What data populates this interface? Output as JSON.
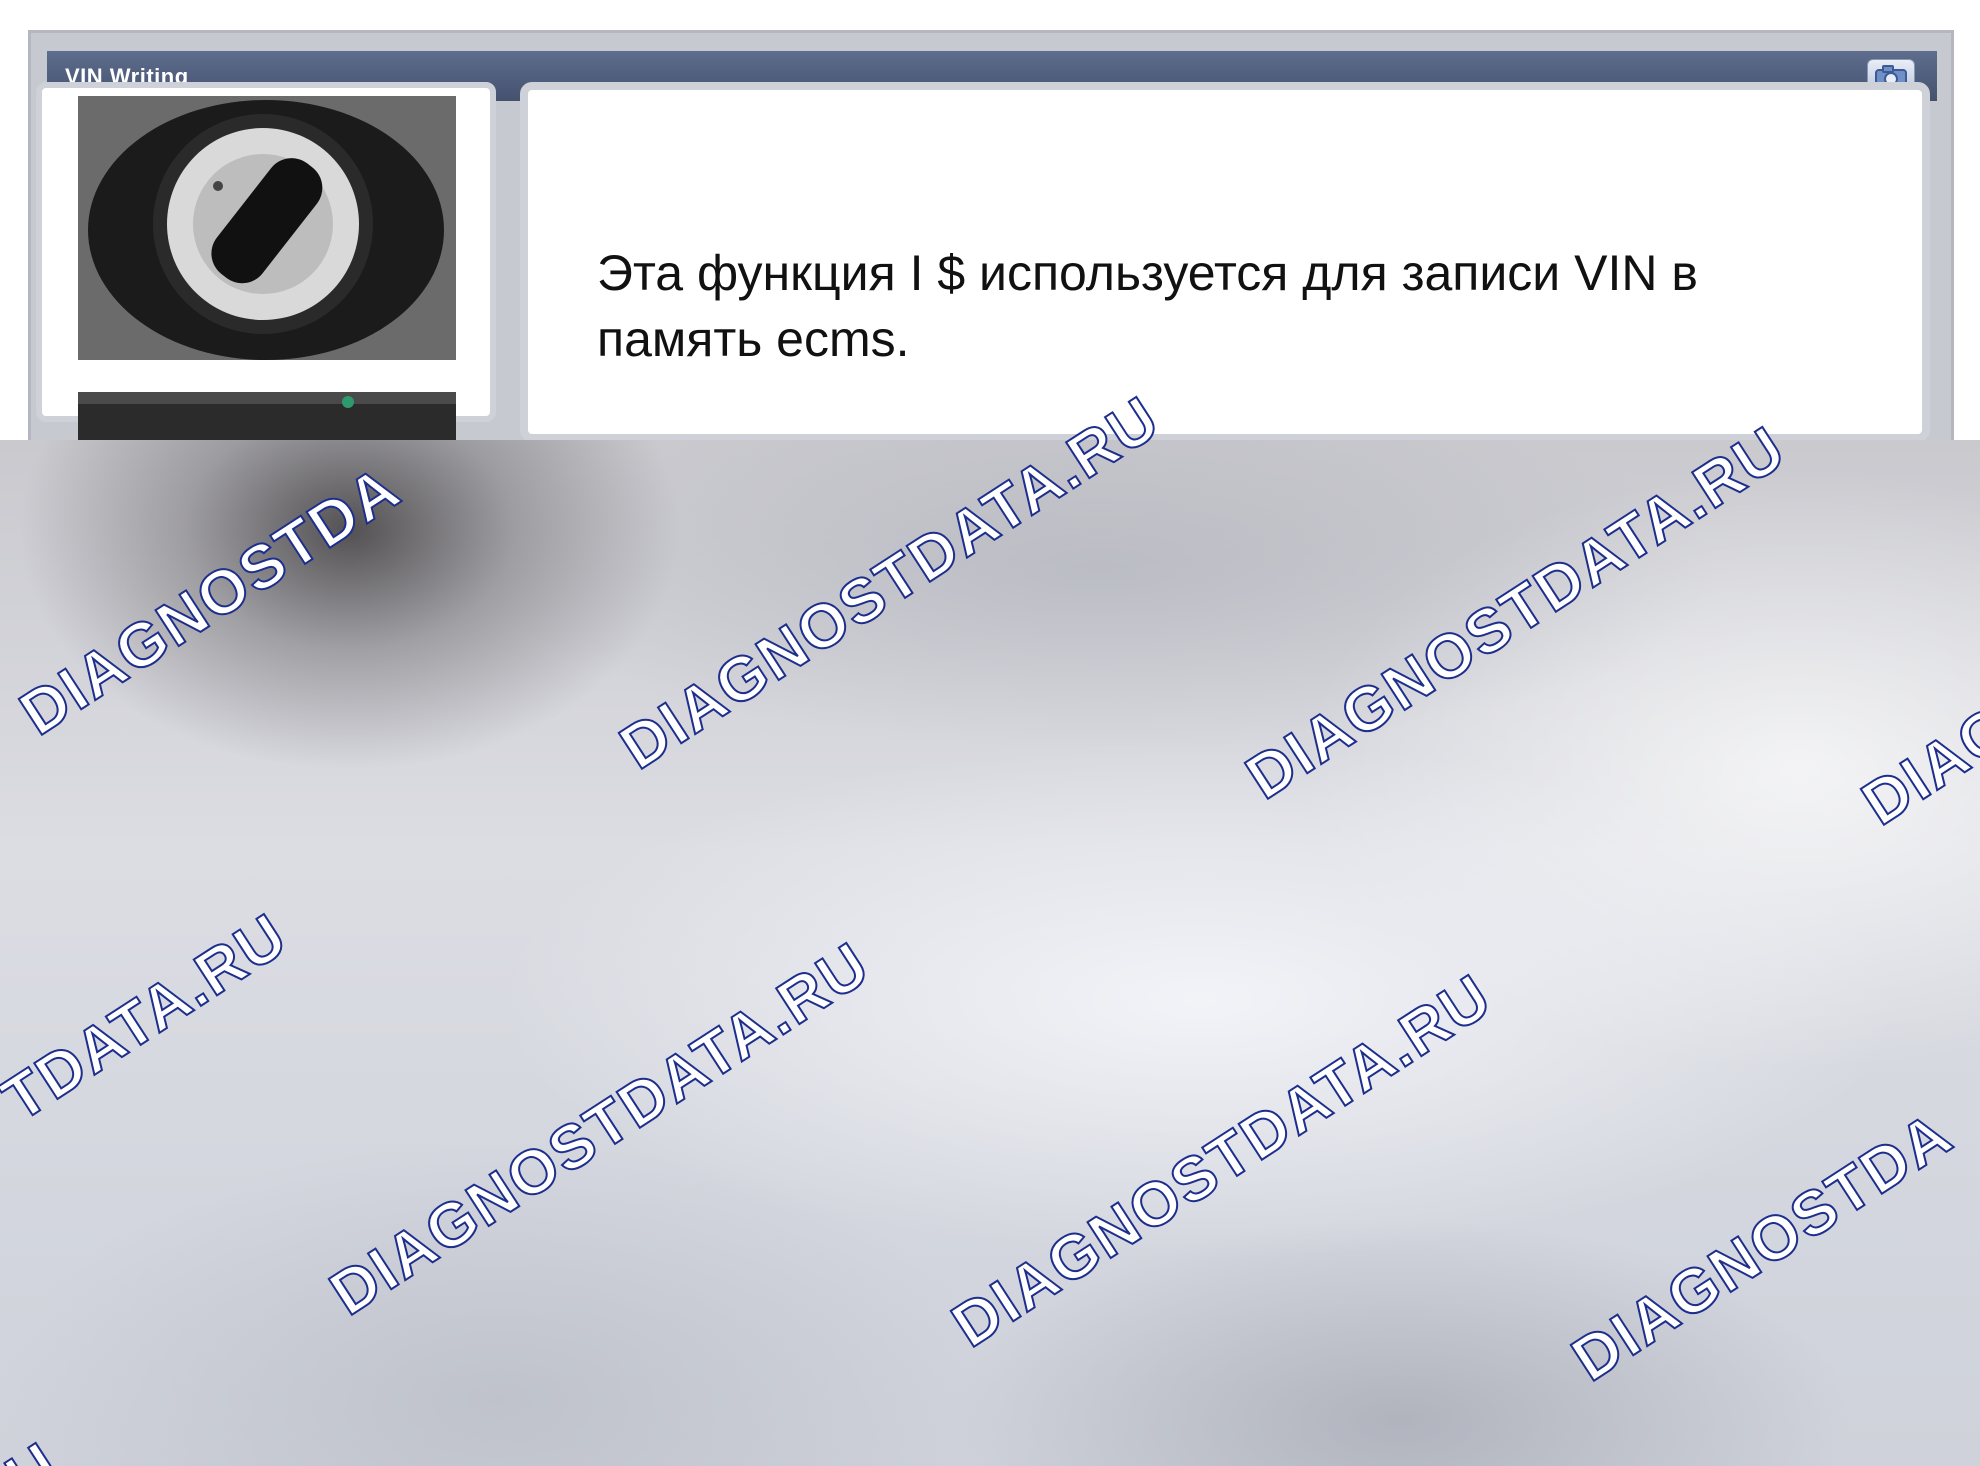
{
  "window": {
    "title": "VIN Writing",
    "camera_icon": "camera-icon",
    "message": "Эта функция I $ используется для записи VIN в память ecms."
  },
  "images": {
    "top": "ignition-switch-photo",
    "bottom": "instrument-photo"
  },
  "watermark": {
    "text_long": "DIAGNOSTDATA.RU",
    "text_partial_1": "DIAGNOSTDA",
    "text_partial_2": "DIAGNOSTDATA.",
    "text_partial_3": "DIA",
    "text_partial_4": "DIAG",
    "text_partial_5": "DIAGNOSTDA",
    "text_partial_6": "TDATA.RU",
    "text_partial_7": "U",
    "color": "#1d2e8c"
  },
  "colors": {
    "titlebar": "#4f5c7d",
    "frame": "#c7c9d0",
    "panel": "#ffffff"
  }
}
